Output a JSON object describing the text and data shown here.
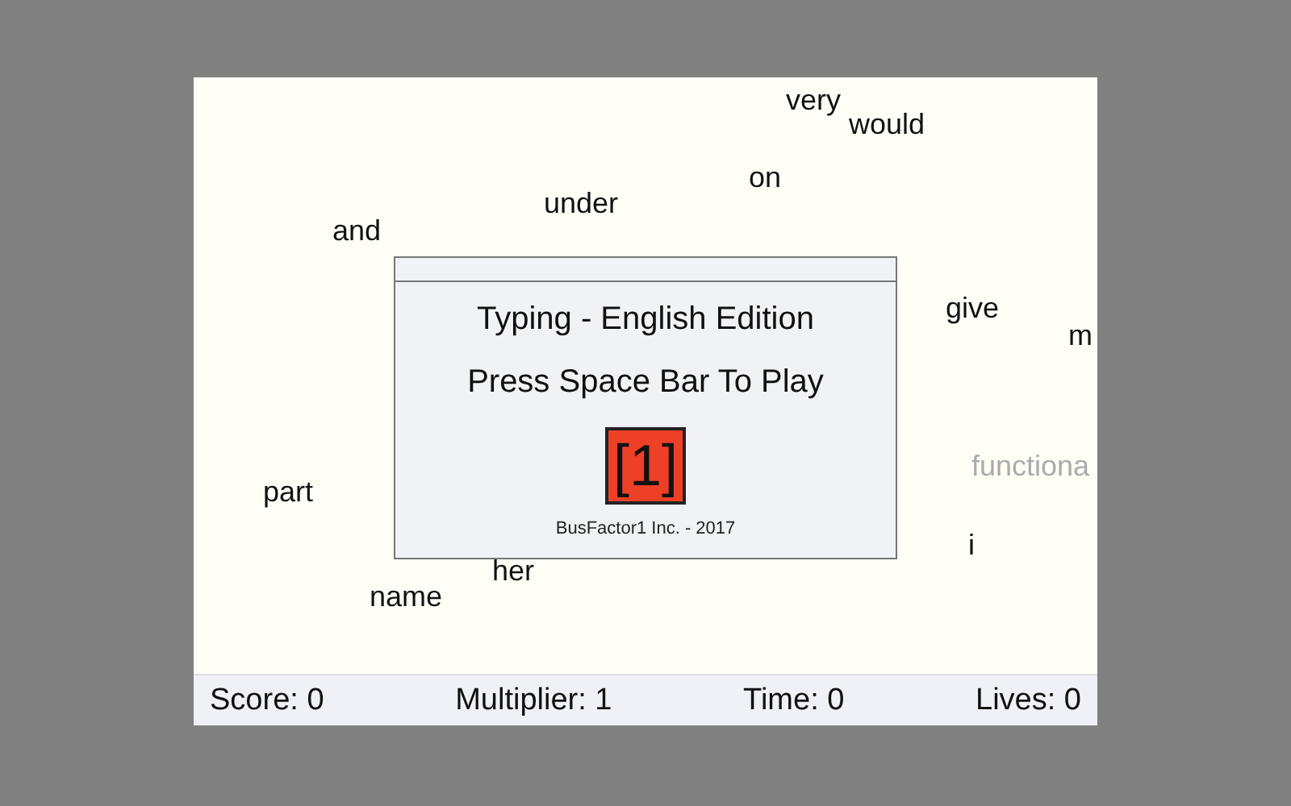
{
  "words": [
    {
      "text": "very",
      "dimmed": false
    },
    {
      "text": "would",
      "dimmed": false
    },
    {
      "text": "on",
      "dimmed": false
    },
    {
      "text": "under",
      "dimmed": false
    },
    {
      "text": "and",
      "dimmed": false
    },
    {
      "text": "give",
      "dimmed": false
    },
    {
      "text": "m",
      "dimmed": false
    },
    {
      "text": "functiona",
      "dimmed": true
    },
    {
      "text": "part",
      "dimmed": false
    },
    {
      "text": "i",
      "dimmed": false
    },
    {
      "text": "her",
      "dimmed": false
    },
    {
      "text": "name",
      "dimmed": false
    }
  ],
  "dialog": {
    "title": "Typing - English Edition",
    "prompt": "Press Space Bar To Play",
    "key": "[1]",
    "credit": "BusFactor1 Inc. - 2017"
  },
  "status_bar": [
    "Score: 0",
    "Multiplier: 1",
    "Time: 0",
    "Lives: 0"
  ]
}
